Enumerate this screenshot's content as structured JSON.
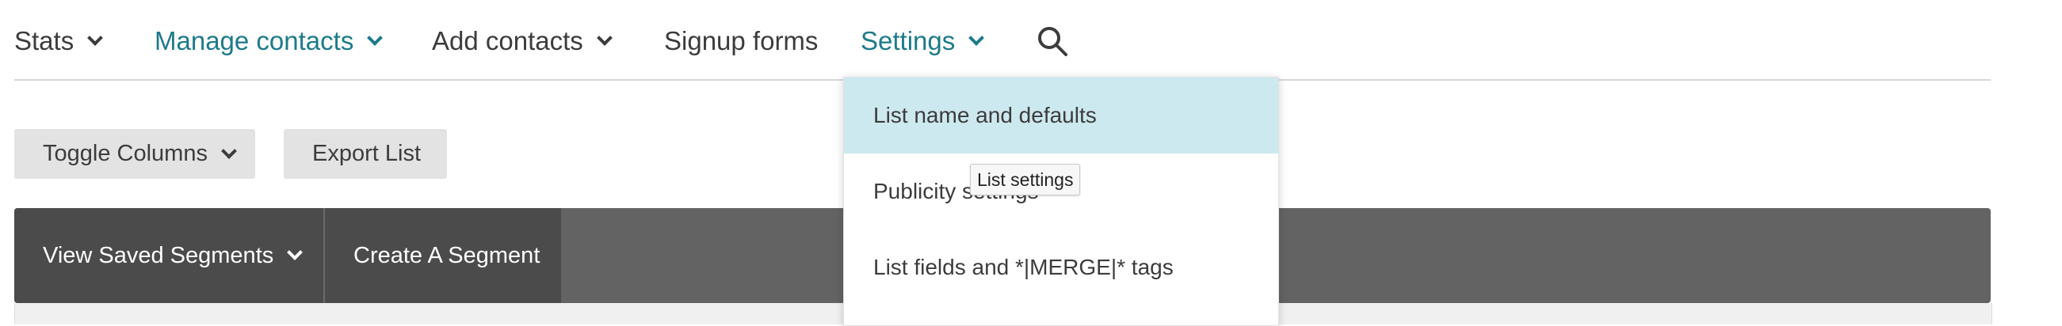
{
  "nav": {
    "items": [
      {
        "label": "Stats"
      },
      {
        "label": "Manage contacts"
      },
      {
        "label": "Add contacts"
      },
      {
        "label": "Signup forms"
      },
      {
        "label": "Settings"
      }
    ],
    "search_icon": "search-icon"
  },
  "toolbar": {
    "toggle_columns_label": "Toggle Columns",
    "export_list_label": "Export List"
  },
  "segments": {
    "view_saved_label": "View Saved Segments",
    "create_label": "Create A Segment"
  },
  "settings_menu": {
    "items": [
      {
        "label": "List name and defaults"
      },
      {
        "label": "Publicity settings"
      },
      {
        "label": "List fields and *|MERGE|* tags"
      }
    ]
  },
  "tooltip": {
    "text": "List settings"
  },
  "colors": {
    "accent_teal": "#1d7a8a",
    "menu_highlight": "#cde9f0",
    "segbar_dark": "#4b4b4b",
    "segbar_mid": "#636363"
  }
}
